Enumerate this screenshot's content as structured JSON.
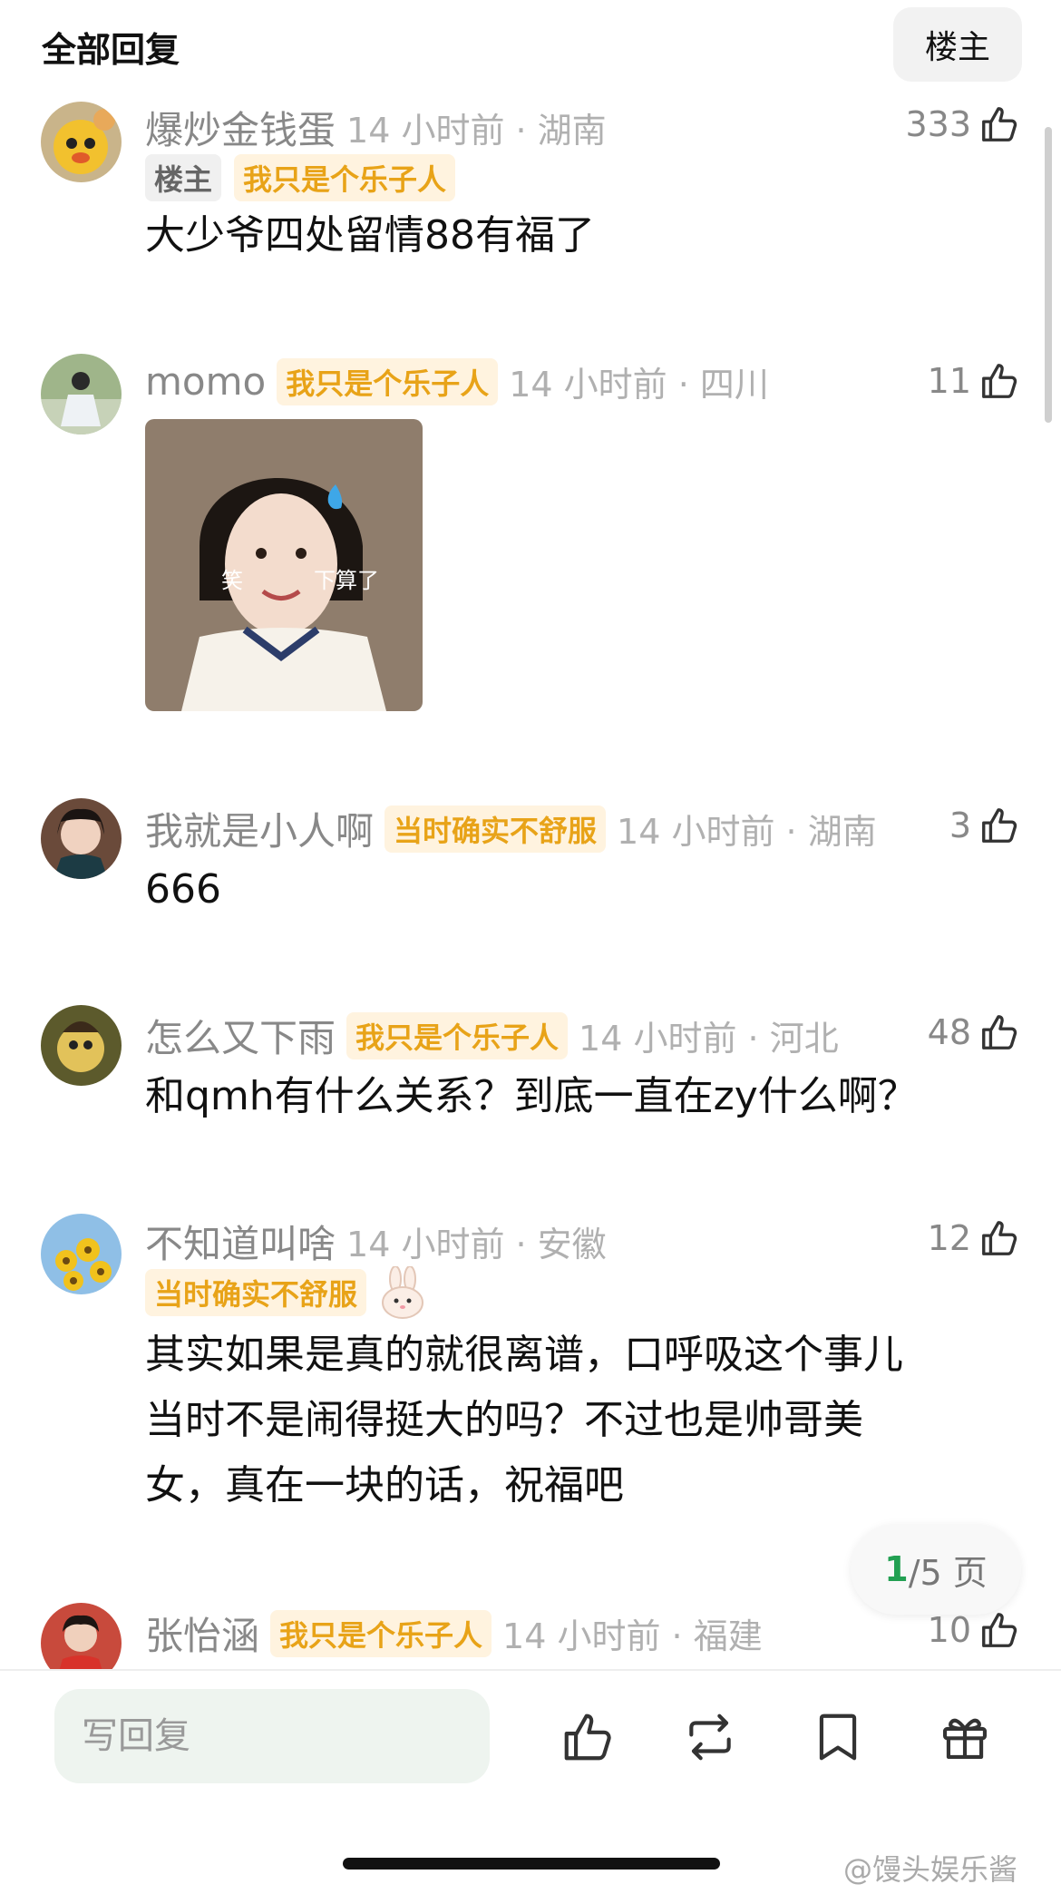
{
  "header": {
    "title": "全部回复",
    "owner_filter": "楼主"
  },
  "comments": [
    {
      "user": "爆炒金钱蛋",
      "owner_badge": "楼主",
      "badge": "我只是个乐子人",
      "time": "14 小时前 · 湖南",
      "likes": "333",
      "text": "大少爷四处留情88有福了"
    },
    {
      "user": "momo",
      "badge": "我只是个乐子人",
      "time": "14 小时前 · 四川",
      "likes": "11",
      "image_caption_left": "笑",
      "image_caption_right": "下算了"
    },
    {
      "user": "我就是小人啊",
      "badge": "当时确实不舒服",
      "time": "14 小时前 · 湖南",
      "likes": "3",
      "text": "666"
    },
    {
      "user": "怎么又下雨",
      "badge": "我只是个乐子人",
      "time": "14 小时前 · 河北",
      "likes": "48",
      "text": "和qmh有什么关系？到底一直在zy什么啊？"
    },
    {
      "user": "不知道叫啥",
      "badge": "当时确实不舒服",
      "time": "14 小时前 · 安徽",
      "likes": "12",
      "text_lines": [
        "其实如果是真的就很离谱，口呼吸这个事儿",
        "当时不是闹得挺大的吗？不过也是帅哥美",
        "女，真在一块的话，祝福吧"
      ]
    },
    {
      "user": "张怡涵",
      "badge": "我只是个乐子人",
      "time": "14 小时前 · 福建",
      "likes": "10"
    }
  ],
  "pager": {
    "current": "1",
    "total_text": "/5 页"
  },
  "reply_bar": {
    "placeholder": "写回复"
  },
  "icons": [
    "thumb-up-icon",
    "repost-icon",
    "bookmark-icon",
    "gift-icon",
    "rabbit-sticker-icon"
  ],
  "watermark": "@馒头娱乐酱",
  "colors": {
    "badge_text": "#e8a318",
    "badge_bg": "#fff3df",
    "pager_current": "#22a052",
    "reply_bg": "#eef4ef"
  }
}
